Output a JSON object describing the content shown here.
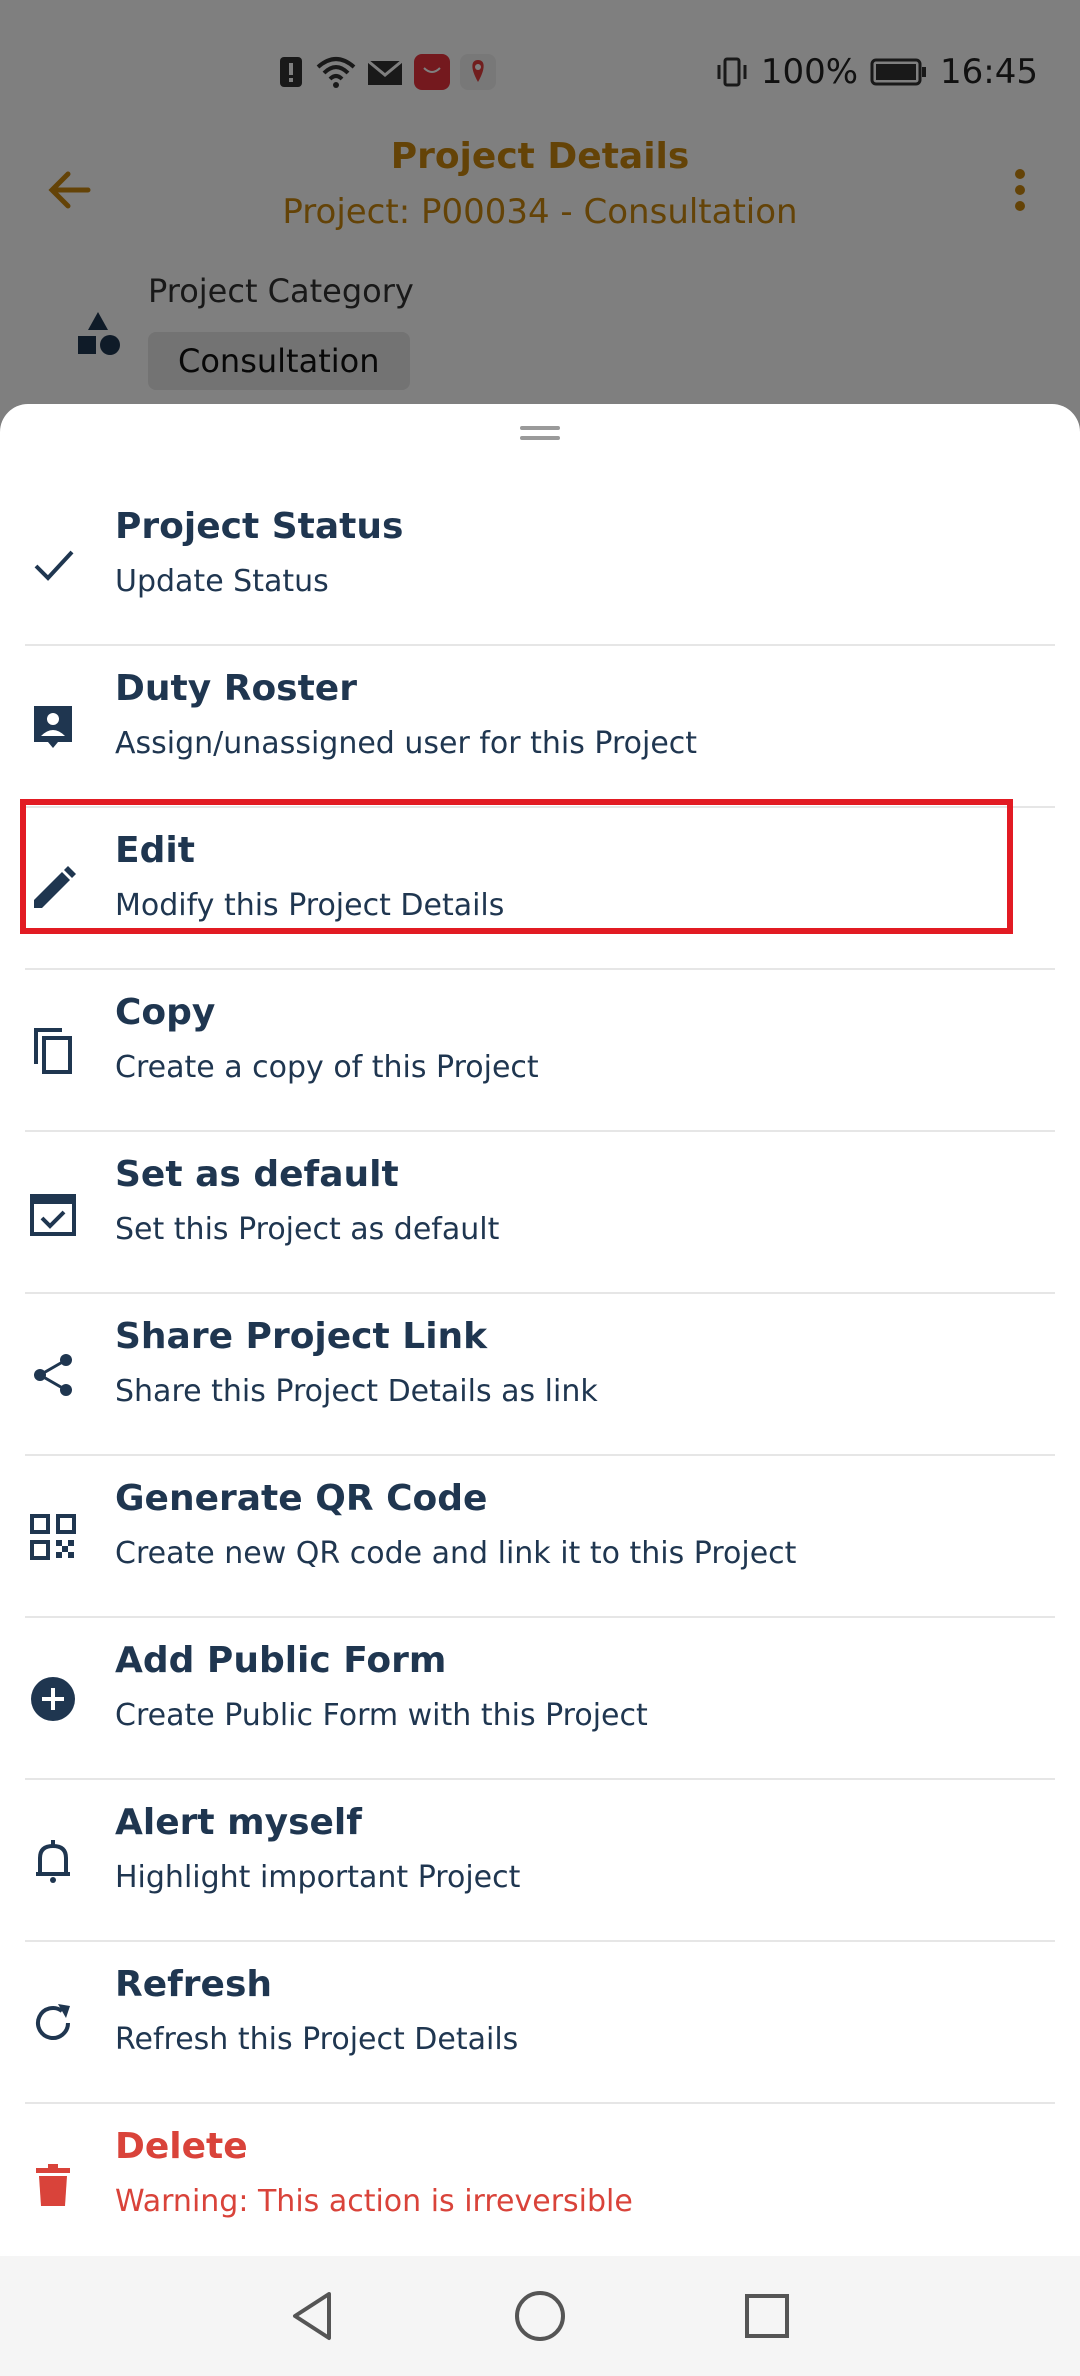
{
  "status_bar": {
    "battery": "100%",
    "time": "16:45"
  },
  "app_bar": {
    "title": "Project Details",
    "subtitle": "Project: P00034 - Consultation"
  },
  "category": {
    "label": "Project Category",
    "value": "Consultation"
  },
  "menu": [
    {
      "label": "Project Status",
      "desc": "Update Status",
      "icon": "check-icon"
    },
    {
      "label": "Duty Roster",
      "desc": "Assign/unassigned user for this Project",
      "icon": "assign-user-icon"
    },
    {
      "label": "Edit",
      "desc": "Modify this Project Details",
      "icon": "pencil-icon"
    },
    {
      "label": "Copy",
      "desc": "Create a copy of this Project",
      "icon": "copy-icon"
    },
    {
      "label": "Set as default",
      "desc": "Set this Project as default",
      "icon": "calendar-check-icon"
    },
    {
      "label": "Share Project Link",
      "desc": "Share this Project Details as link",
      "icon": "share-icon"
    },
    {
      "label": "Generate QR Code",
      "desc": "Create new QR code and link it to this Project",
      "icon": "qr-code-icon"
    },
    {
      "label": "Add Public Form",
      "desc": "Create Public Form with this Project",
      "icon": "add-circle-icon"
    },
    {
      "label": "Alert myself",
      "desc": "Highlight important Project",
      "icon": "bell-icon"
    },
    {
      "label": "Refresh",
      "desc": "Refresh this Project Details",
      "icon": "refresh-icon"
    },
    {
      "label": "Delete",
      "desc": "Warning: This action is irreversible",
      "icon": "trash-icon"
    }
  ],
  "colors": {
    "accent": "#c8860f",
    "text": "#1f3650",
    "danger": "#d9433a",
    "highlight": "#e21b23"
  }
}
